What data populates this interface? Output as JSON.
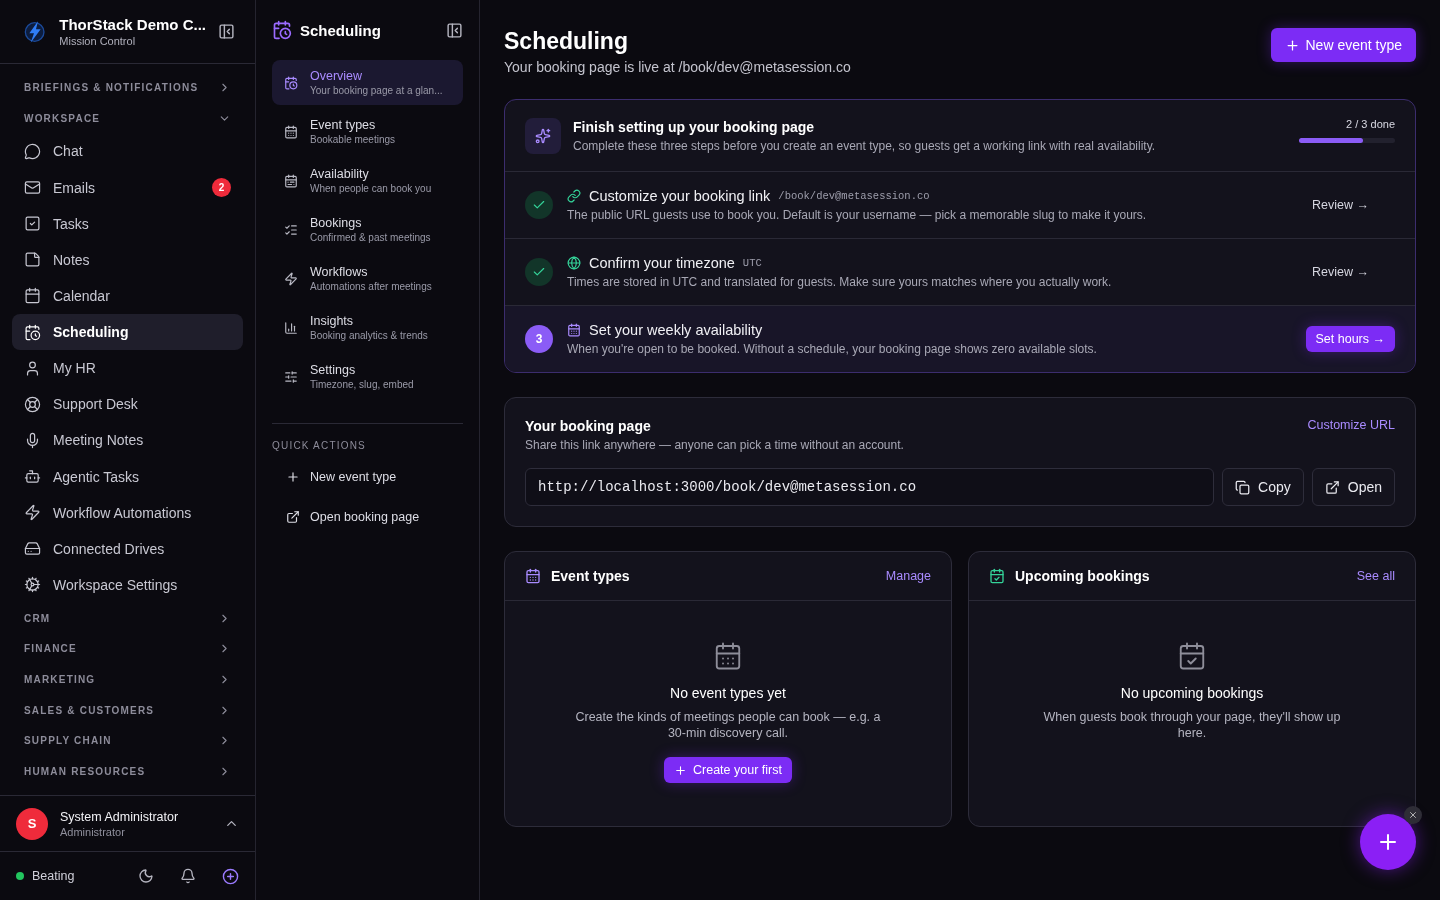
{
  "app": {
    "name": "ThorStack Demo C...",
    "subtitle": "Mission Control"
  },
  "nav": [
    {
      "kind": "section",
      "label": "BRIEFINGS & NOTIFICATIONS",
      "expanded": false
    },
    {
      "kind": "section",
      "label": "WORKSPACE",
      "expanded": true
    },
    {
      "kind": "item",
      "label": "Chat",
      "selected": false
    },
    {
      "kind": "item",
      "label": "Emails",
      "selected": false,
      "badge": "2"
    },
    {
      "kind": "item",
      "label": "Tasks",
      "selected": false
    },
    {
      "kind": "item",
      "label": "Notes",
      "selected": false
    },
    {
      "kind": "item",
      "label": "Calendar",
      "selected": false
    },
    {
      "kind": "item",
      "label": "Scheduling",
      "selected": true
    },
    {
      "kind": "item",
      "label": "My HR",
      "selected": false
    },
    {
      "kind": "item",
      "label": "Support Desk",
      "selected": false
    },
    {
      "kind": "item",
      "label": "Meeting Notes",
      "selected": false
    },
    {
      "kind": "item",
      "label": "Agentic Tasks",
      "selected": false
    },
    {
      "kind": "item",
      "label": "Workflow Automations",
      "selected": false
    },
    {
      "kind": "item",
      "label": "Connected Drives",
      "selected": false
    },
    {
      "kind": "item",
      "label": "Workspace Settings",
      "selected": false
    },
    {
      "kind": "section",
      "label": "CRM",
      "expanded": false
    },
    {
      "kind": "section",
      "label": "FINANCE",
      "expanded": false
    },
    {
      "kind": "section",
      "label": "MARKETING",
      "expanded": false
    },
    {
      "kind": "section",
      "label": "SALES & CUSTOMERS",
      "expanded": false
    },
    {
      "kind": "section",
      "label": "SUPPLY CHAIN",
      "expanded": false
    },
    {
      "kind": "section",
      "label": "HUMAN RESOURCES",
      "expanded": false
    }
  ],
  "user": {
    "initial": "S",
    "name": "System Administrator",
    "role": "Administrator"
  },
  "status": {
    "label": "Beating",
    "online": true
  },
  "subnav": {
    "title": "Scheduling",
    "items": [
      {
        "label": "Overview",
        "hint": "Your booking page at a glan...",
        "selected": true
      },
      {
        "label": "Event types",
        "hint": "Bookable meetings",
        "selected": false
      },
      {
        "label": "Availability",
        "hint": "When people can book you",
        "selected": false
      },
      {
        "label": "Bookings",
        "hint": "Confirmed & past meetings",
        "selected": false
      },
      {
        "label": "Workflows",
        "hint": "Automations after meetings",
        "selected": false
      },
      {
        "label": "Insights",
        "hint": "Booking analytics & trends",
        "selected": false
      },
      {
        "label": "Settings",
        "hint": "Timezone, slug, embed",
        "selected": false
      }
    ],
    "quick_title": "QUICK ACTIONS",
    "quick_actions": [
      "New event type",
      "Open booking page"
    ]
  },
  "page": {
    "title": "Scheduling",
    "subtitle": "Your booking page is live at /book/dev@metasession.co",
    "new_button": "New event type"
  },
  "setup": {
    "title": "Finish setting up your booking page",
    "description": "Complete these three steps before you create an event type, so guests get a working link with real availability.",
    "progress_label": "2 / 3 done",
    "level": 0.67,
    "steps": [
      {
        "done": true,
        "title": "Customize your booking link",
        "tag": "/book/dev@metasession.co",
        "description": "The public URL guests use to book you. Default is your username — pick a memorable slug to make it yours.",
        "action": "Review →"
      },
      {
        "done": true,
        "title": "Confirm your timezone",
        "tag": "UTC",
        "description": "Times are stored in UTC and translated for guests. Make sure yours matches where you actually work.",
        "action": "Review →"
      },
      {
        "done": false,
        "number": "3",
        "title": "Set your weekly availability",
        "description": "When you're open to be booked. Without a schedule, your booking page shows zero available slots.",
        "action": "Set hours →"
      }
    ]
  },
  "booking_page": {
    "title": "Your booking page",
    "description": "Share this link anywhere — anyone can pick a time without an account.",
    "link": "Customize URL",
    "url": "http://localhost:3000/book/dev@metasession.co",
    "copy": "Copy",
    "open": "Open"
  },
  "panels": [
    {
      "title": "Event types",
      "link": "Manage",
      "empty_title": "No event types yet",
      "empty_text": "Create the kinds of meetings people can book — e.g. a 30-min discovery call.",
      "button": "Create your first"
    },
    {
      "title": "Upcoming bookings",
      "link": "See all",
      "empty_title": "No upcoming bookings",
      "empty_text": "When guests book through your page, they'll show up here."
    }
  ]
}
